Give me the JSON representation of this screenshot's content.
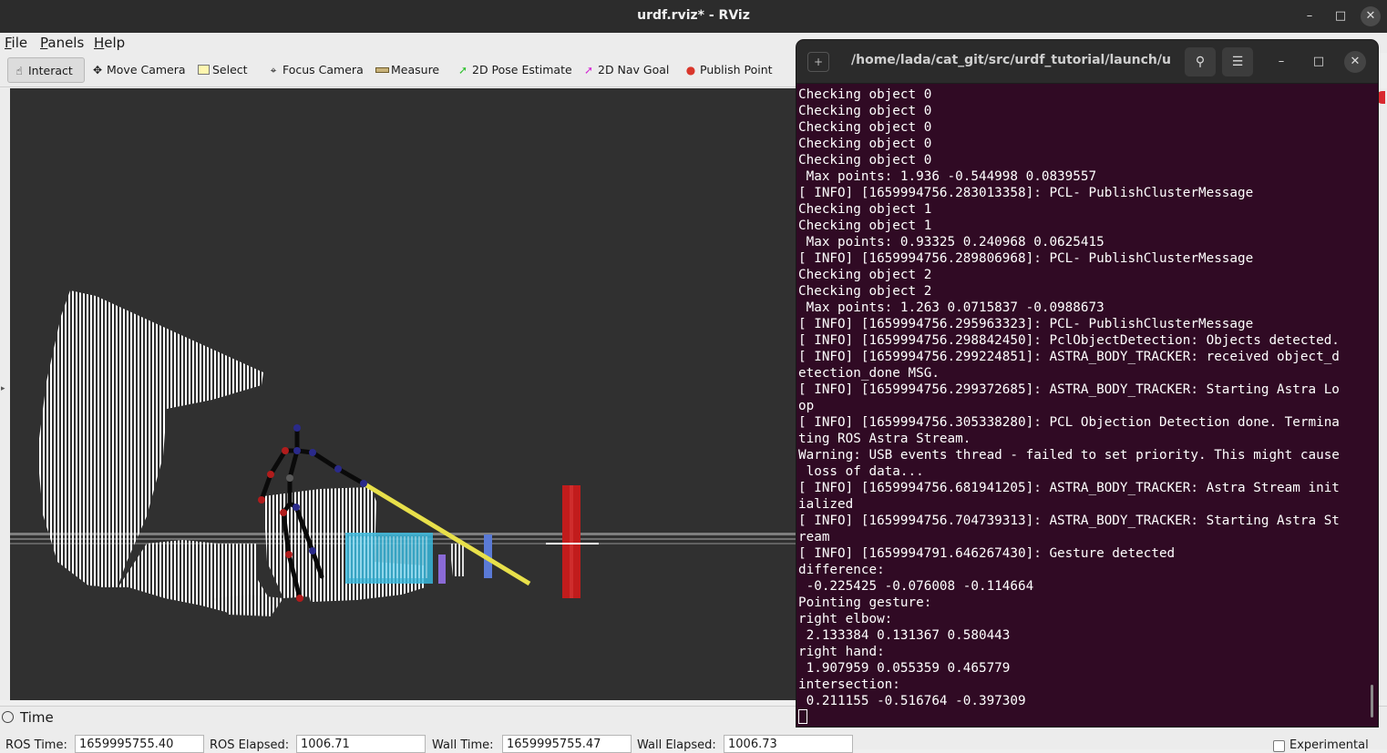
{
  "window": {
    "title": "urdf.rviz* - RViz"
  },
  "menu": [
    {
      "label": "File",
      "u": "F",
      "rest": "ile"
    },
    {
      "label": "Panels",
      "u": "P",
      "rest": "anels"
    },
    {
      "label": "Help",
      "u": "H",
      "rest": "elp"
    }
  ],
  "toolbar": {
    "interact": "Interact",
    "move_camera": "Move Camera",
    "select": "Select",
    "focus_camera": "Focus Camera",
    "measure": "Measure",
    "pose_estimate": "2D Pose Estimate",
    "nav_goal": "2D Nav Goal",
    "publish_point": "Publish Point",
    "colors": {
      "pose_estimate": "#2fc12f",
      "nav_goal": "#d42ad4",
      "publish_point": "#d9362b"
    }
  },
  "time_panel": {
    "title": "Time",
    "ros_time_label": "ROS Time:",
    "ros_time": "1659995755.40",
    "ros_elapsed_label": "ROS Elapsed:",
    "ros_elapsed": "1006.71",
    "wall_time_label": "Wall Time:",
    "wall_time": "1659995755.47",
    "wall_elapsed_label": "Wall Elapsed:",
    "wall_elapsed": "1006.73",
    "experimental": "Experimental"
  },
  "terminal": {
    "title": "/home/lada/cat_git/src/urdf_tutorial/launch/u...",
    "lines": [
      "Checking object 0",
      "Checking object 0",
      "Checking object 0",
      "Checking object 0",
      "Checking object 0",
      " Max points: 1.936 -0.544998 0.0839557",
      "[ INFO] [1659994756.283013358]: PCL- PublishClusterMessage",
      "Checking object 1",
      "Checking object 1",
      " Max points: 0.93325 0.240968 0.0625415",
      "[ INFO] [1659994756.289806968]: PCL- PublishClusterMessage",
      "Checking object 2",
      "Checking object 2",
      " Max points: 1.263 0.0715837 -0.0988673",
      "[ INFO] [1659994756.295963323]: PCL- PublishClusterMessage",
      "[ INFO] [1659994756.298842450]: PclObjectDetection: Objects detected.",
      "[ INFO] [1659994756.299224851]: ASTRA_BODY_TRACKER: received object_d",
      "etection_done MSG.",
      "[ INFO] [1659994756.299372685]: ASTRA_BODY_TRACKER: Starting Astra Lo",
      "op",
      "[ INFO] [1659994756.305338280]: PCL Objection Detection done. Termina",
      "ting ROS Astra Stream.",
      "Warning: USB events thread - failed to set priority. This might cause",
      " loss of data...",
      "[ INFO] [1659994756.681941205]: ASTRA_BODY_TRACKER: Astra Stream init",
      "ialized",
      "[ INFO] [1659994756.704739313]: ASTRA_BODY_TRACKER: Starting Astra St",
      "ream",
      "[ INFO] [1659994791.646267430]: Gesture detected",
      "difference:",
      " -0.225425 -0.076008 -0.114664",
      "Pointing gesture:",
      "right elbow:",
      " 2.133384 0.131367 0.580443",
      "right hand:",
      " 1.907959 0.055359 0.465779",
      "intersection:",
      " 0.211155 -0.516764 -0.397309"
    ]
  }
}
